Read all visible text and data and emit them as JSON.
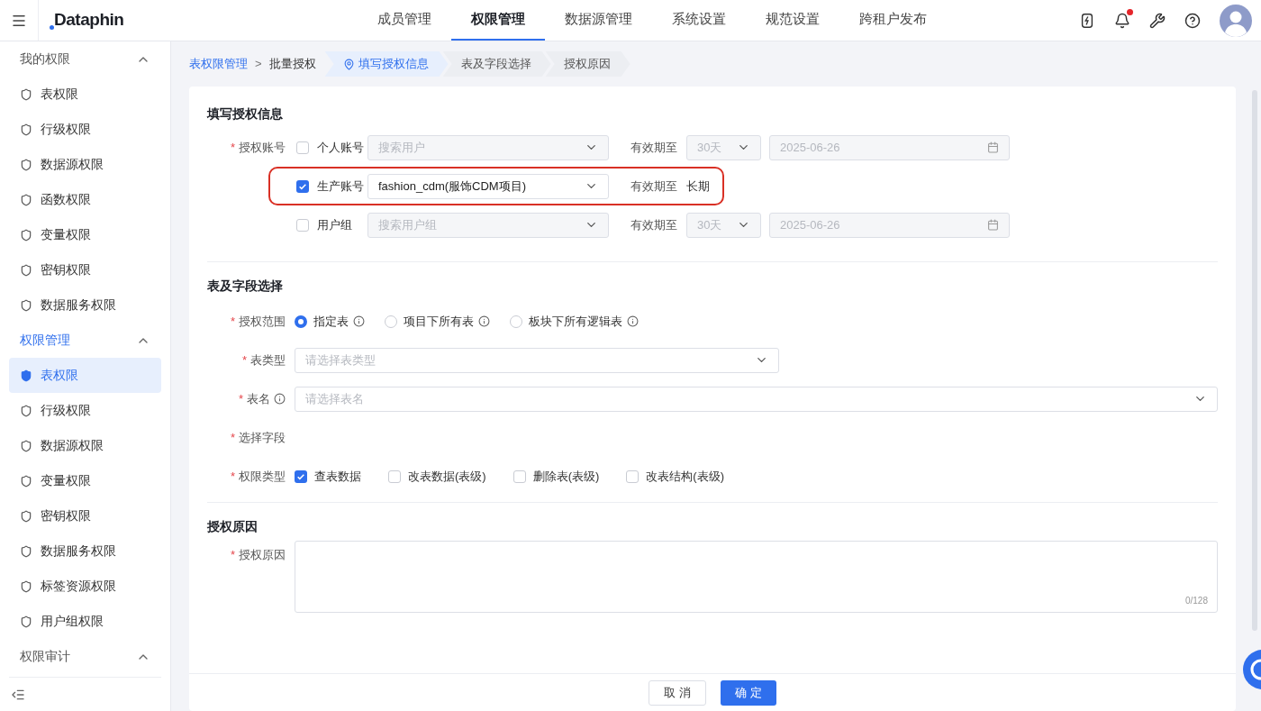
{
  "header": {
    "logo": "Dataphin",
    "notification_dot": true,
    "nav": [
      {
        "label": "成员管理",
        "selected": false
      },
      {
        "label": "权限管理",
        "selected": true
      },
      {
        "label": "数据源管理",
        "selected": false
      },
      {
        "label": "系统设置",
        "selected": false
      },
      {
        "label": "规范设置",
        "selected": false
      },
      {
        "label": "跨租户发布",
        "selected": false
      }
    ]
  },
  "sidebar": {
    "groups": [
      {
        "title": "我的权限",
        "expanded": true,
        "active": false,
        "items": [
          {
            "label": "表权限",
            "selected": false
          },
          {
            "label": "行级权限",
            "selected": false
          },
          {
            "label": "数据源权限",
            "selected": false
          },
          {
            "label": "函数权限",
            "selected": false
          },
          {
            "label": "变量权限",
            "selected": false
          },
          {
            "label": "密钥权限",
            "selected": false
          },
          {
            "label": "数据服务权限",
            "selected": false
          }
        ]
      },
      {
        "title": "权限管理",
        "expanded": true,
        "active": true,
        "items": [
          {
            "label": "表权限",
            "selected": true
          },
          {
            "label": "行级权限",
            "selected": false
          },
          {
            "label": "数据源权限",
            "selected": false
          },
          {
            "label": "变量权限",
            "selected": false
          },
          {
            "label": "密钥权限",
            "selected": false
          },
          {
            "label": "数据服务权限",
            "selected": false
          },
          {
            "label": "标签资源权限",
            "selected": false
          },
          {
            "label": "用户组权限",
            "selected": false
          }
        ]
      },
      {
        "title": "权限审计",
        "expanded": true,
        "active": false
      }
    ]
  },
  "breadcrumb": {
    "root": "表权限管理",
    "separator": ">",
    "current": "批量授权",
    "steps": [
      {
        "label": "填写授权信息",
        "selected": true
      },
      {
        "label": "表及字段选择",
        "selected": false
      },
      {
        "label": "授权原因",
        "selected": false
      }
    ]
  },
  "account_section": {
    "title": "填写授权信息",
    "label": "授权账号",
    "required_mark": "*",
    "rows": [
      {
        "label": "个人账号",
        "checked": false,
        "highlighted": false,
        "placeholder": "搜索用户",
        "expiry_label": "有效期至",
        "expiry": {
          "kind": "select",
          "value": "30天",
          "date": "2025-06-26"
        }
      },
      {
        "label": "生产账号",
        "checked": true,
        "highlighted": true,
        "value": "fashion_cdm(服饰CDM项目)",
        "expiry_label": "有效期至",
        "expiry": {
          "kind": "text",
          "value": "长期"
        }
      },
      {
        "label": "用户组",
        "checked": false,
        "highlighted": false,
        "placeholder": "搜索用户组",
        "expiry_label": "有效期至",
        "expiry": {
          "kind": "select",
          "value": "30天",
          "date": "2025-06-26"
        }
      }
    ]
  },
  "table_section": {
    "title": "表及字段选择",
    "scope": {
      "label": "授权范围",
      "required_mark": "*",
      "options": [
        {
          "label": "指定表",
          "selected": true
        },
        {
          "label": "项目下所有表",
          "selected": false
        },
        {
          "label": "板块下所有逻辑表",
          "selected": false
        }
      ]
    },
    "table_type": {
      "label": "表类型",
      "required_mark": "*",
      "placeholder": "请选择表类型"
    },
    "table_name": {
      "label": "表名",
      "required_mark": "*",
      "placeholder": "请选择表名"
    },
    "fields": {
      "label": "选择字段",
      "required_mark": "*"
    },
    "permission_types": {
      "label": "权限类型",
      "required_mark": "*",
      "options": [
        {
          "label": "查表数据",
          "checked": true
        },
        {
          "label": "改表数据(表级)",
          "checked": false
        },
        {
          "label": "删除表(表级)",
          "checked": false
        },
        {
          "label": "改表结构(表级)",
          "checked": false
        }
      ]
    }
  },
  "reason_section": {
    "title": "授权原因",
    "label": "授权原因",
    "required_mark": "*",
    "counter": "0/128"
  },
  "footer": {
    "buttons": [
      {
        "label": "取 消",
        "kind": "secondary"
      },
      {
        "label": "确 定",
        "kind": "primary"
      }
    ]
  }
}
